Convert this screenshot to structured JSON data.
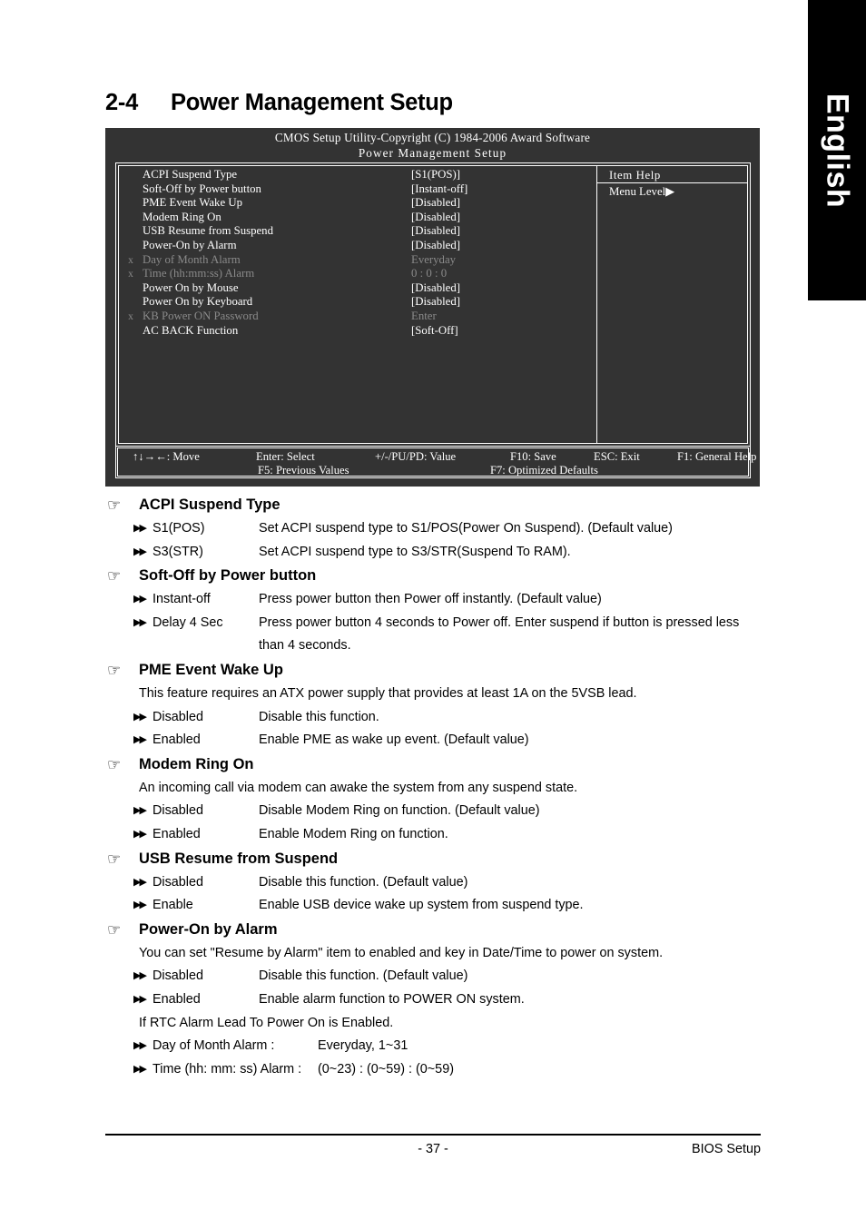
{
  "side_tab": {
    "label": "English"
  },
  "heading": {
    "number": "2-4",
    "title": "Power Management Setup"
  },
  "bios": {
    "title_line1": "CMOS Setup Utility-Copyright (C) 1984-2006 Award Software",
    "title_line2": "Power Management Setup",
    "rows": [
      {
        "x": "",
        "name": "ACPI Suspend Type",
        "value": "[S1(POS)]",
        "dim": false
      },
      {
        "x": "",
        "name": "Soft-Off by Power button",
        "value": "[Instant-off]",
        "dim": false
      },
      {
        "x": "",
        "name": "PME Event Wake Up",
        "value": "[Disabled]",
        "dim": false
      },
      {
        "x": "",
        "name": "Modem Ring On",
        "value": "[Disabled]",
        "dim": false
      },
      {
        "x": "",
        "name": "USB Resume from Suspend",
        "value": "[Disabled]",
        "dim": false
      },
      {
        "x": "",
        "name": "Power-On by Alarm",
        "value": "[Disabled]",
        "dim": false
      },
      {
        "x": "x",
        "name": "Day of Month Alarm",
        "value": "Everyday",
        "dim": true
      },
      {
        "x": "x",
        "name": "Time (hh:mm:ss) Alarm",
        "value": "0 : 0 : 0",
        "dim": true
      },
      {
        "x": "",
        "name": "Power On by Mouse",
        "value": "[Disabled]",
        "dim": false
      },
      {
        "x": "",
        "name": "Power On by Keyboard",
        "value": "[Disabled]",
        "dim": false
      },
      {
        "x": "x",
        "name": "KB Power ON Password",
        "value": "Enter",
        "dim": true
      },
      {
        "x": "",
        "name": "AC BACK Function",
        "value": "[Soft-Off]",
        "dim": false
      }
    ],
    "help": {
      "title": "Item Help",
      "menu_level": "Menu Level▶"
    },
    "footer": {
      "move": "↑↓→←: Move",
      "select": "Enter: Select",
      "value": "+/-/PU/PD: Value",
      "save": "F10: Save",
      "exit": "ESC: Exit",
      "general_help": "F1: General Help",
      "previous_values": "F5: Previous Values",
      "optimized_defaults": "F7: Optimized Defaults"
    }
  },
  "sections": [
    {
      "title": "ACPI Suspend Type",
      "note": "",
      "items": [
        {
          "key": "S1(POS)",
          "desc": "Set ACPI suspend type to S1/POS(Power On Suspend). (Default value)"
        },
        {
          "key": "S3(STR)",
          "desc": "Set ACPI suspend type to S3/STR(Suspend To RAM)."
        }
      ]
    },
    {
      "title": "Soft-Off by Power button",
      "note": "",
      "items": [
        {
          "key": "Instant-off",
          "desc": "Press power button then Power off instantly. (Default value)"
        },
        {
          "key": "Delay 4 Sec",
          "desc": "Press power button 4 seconds to Power off. Enter suspend if button is pressed less",
          "cont": "than 4 seconds."
        }
      ]
    },
    {
      "title": "PME Event Wake Up",
      "note": "This feature requires an ATX power supply that provides at least 1A on the 5VSB lead.",
      "items": [
        {
          "key": "Disabled",
          "desc": "Disable this function."
        },
        {
          "key": "Enabled",
          "desc": "Enable PME as wake up event. (Default value)"
        }
      ]
    },
    {
      "title": "Modem Ring On",
      "note": "An incoming call via modem can awake the system from any suspend state.",
      "items": [
        {
          "key": "Disabled",
          "desc": "Disable Modem Ring on function. (Default value)"
        },
        {
          "key": "Enabled",
          "desc": "Enable Modem Ring on function."
        }
      ]
    },
    {
      "title": "USB Resume from Suspend",
      "note": "",
      "items": [
        {
          "key": "Disabled",
          "desc": "Disable this function. (Default value)"
        },
        {
          "key": "Enable",
          "desc": "Enable USB device wake up system from suspend type."
        }
      ]
    },
    {
      "title": "Power-On by Alarm",
      "note": "You can set \"Resume by Alarm\" item to enabled and key in Date/Time to power on system.",
      "items": [
        {
          "key": "Disabled",
          "desc": "Disable this function. (Default value)"
        },
        {
          "key": "Enabled",
          "desc": "Enable alarm function to POWER ON system."
        }
      ],
      "note2": "If RTC Alarm Lead To Power On is Enabled.",
      "items2": [
        {
          "key": "Day of Month Alarm :",
          "desc": "Everyday,  1~31"
        },
        {
          "key": "Time (hh: mm: ss) Alarm :",
          "desc": "(0~23) : (0~59) : (0~59)"
        }
      ]
    }
  ],
  "footer": {
    "page_number": "- 37 -",
    "section_label": "BIOS Setup"
  },
  "icons": {
    "hand": "☞",
    "bullet": "▶▶"
  }
}
